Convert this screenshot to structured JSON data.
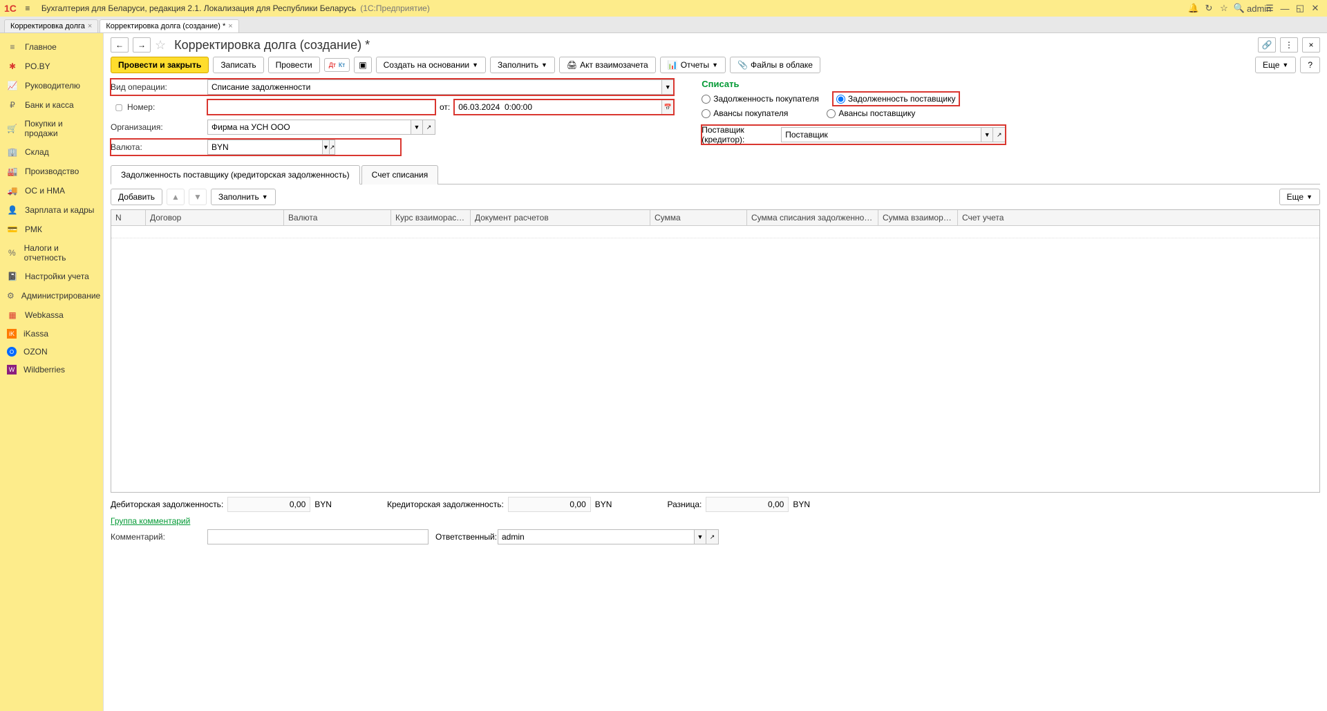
{
  "titlebar": {
    "logo": "1C",
    "title": "Бухгалтерия для Беларуси, редакция 2.1. Локализация для Республики Беларусь",
    "sub": "(1С:Предприятие)",
    "user": "admin"
  },
  "window_tabs": [
    {
      "label": "Корректировка долга",
      "active": false
    },
    {
      "label": "Корректировка долга (создание) *",
      "active": true
    }
  ],
  "sidebar": [
    {
      "label": "Главное",
      "icon": "menu"
    },
    {
      "label": "PO.BY",
      "icon": "poby"
    },
    {
      "label": "Руководителю",
      "icon": "chart"
    },
    {
      "label": "Банк и касса",
      "icon": "bank"
    },
    {
      "label": "Покупки и продажи",
      "icon": "cart"
    },
    {
      "label": "Склад",
      "icon": "warehouse"
    },
    {
      "label": "Производство",
      "icon": "factory"
    },
    {
      "label": "ОС и НМА",
      "icon": "truck"
    },
    {
      "label": "Зарплата и кадры",
      "icon": "person"
    },
    {
      "label": "РМК",
      "icon": "rmk"
    },
    {
      "label": "Налоги и отчетность",
      "icon": "tax"
    },
    {
      "label": "Настройки учета",
      "icon": "settings"
    },
    {
      "label": "Администрирование",
      "icon": "gear"
    },
    {
      "label": "Webkassa",
      "icon": "webkassa"
    },
    {
      "label": "iKassa",
      "icon": "ikassa"
    },
    {
      "label": "OZON",
      "icon": "ozon"
    },
    {
      "label": "Wildberries",
      "icon": "wb"
    }
  ],
  "form": {
    "title": "Корректировка долга (создание) *",
    "toolbar": {
      "post_close": "Провести и закрыть",
      "save": "Записать",
      "post": "Провести",
      "create_based": "Создать на основании",
      "fill": "Заполнить",
      "netting_act": "Акт взаимозачета",
      "reports": "Отчеты",
      "cloud_files": "Файлы в облаке",
      "more": "Еще",
      "help": "?"
    },
    "fields": {
      "operation_type_label": "Вид операции:",
      "operation_type_value": "Списание задолженности",
      "number_label": "Номер:",
      "number_value": "",
      "date_label": "от:",
      "date_value": "06.03.2024  0:00:00",
      "org_label": "Организация:",
      "org_value": "Фирма на УСН ООО",
      "currency_label": "Валюта:",
      "currency_value": "BYN"
    },
    "right": {
      "title": "Списать",
      "r1a": "Задолженность покупателя",
      "r1b": "Задолженность поставщику",
      "r2a": "Авансы покупателя",
      "r2b": "Авансы поставщику",
      "supplier_label": "Поставщик (кредитор):",
      "supplier_value": "Поставщик"
    },
    "tabs": {
      "t1": "Задолженность поставщику (кредиторская задолженность)",
      "t2": "Счет списания"
    },
    "subtoolbar": {
      "add": "Добавить",
      "fill": "Заполнить",
      "more": "Еще"
    },
    "grid_cols": [
      "N",
      "Договор",
      "Валюта",
      "Курс взаиморасчетов",
      "Документ расчетов",
      "Сумма",
      "Сумма списания задолженности (НУ)",
      "Сумма взаиморас...",
      "Счет учета"
    ],
    "totals": {
      "debit_label": "Дебиторская задолженность:",
      "debit_value": "0,00",
      "debit_cur": "BYN",
      "credit_label": "Кредиторская задолженность:",
      "credit_value": "0,00",
      "credit_cur": "BYN",
      "diff_label": "Разница:",
      "diff_value": "0,00",
      "diff_cur": "BYN"
    },
    "footer": {
      "group_link": "Группа комментарий",
      "comment_label": "Комментарий:",
      "comment_value": "",
      "responsible_label": "Ответственный:",
      "responsible_value": "admin"
    }
  }
}
